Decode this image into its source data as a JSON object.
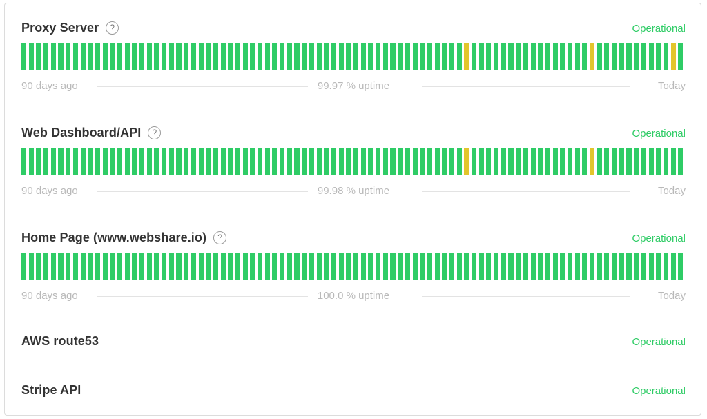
{
  "components": [
    {
      "name": "Proxy Server",
      "has_help": true,
      "help_icon": "question-circle-icon",
      "status": "Operational",
      "uptime_days": 90,
      "minor_days": [
        60,
        77,
        88
      ],
      "left_label": "90 days ago",
      "uptime_label": "99.97 % uptime",
      "right_label": "Today"
    },
    {
      "name": "Web Dashboard/API",
      "has_help": true,
      "help_icon": "question-circle-icon",
      "status": "Operational",
      "uptime_days": 90,
      "minor_days": [
        60,
        77
      ],
      "left_label": "90 days ago",
      "uptime_label": "99.98 % uptime",
      "right_label": "Today"
    },
    {
      "name": "Home Page (www.webshare.io)",
      "has_help": true,
      "help_icon": "question-circle-icon",
      "status": "Operational",
      "uptime_days": 90,
      "minor_days": [],
      "left_label": "90 days ago",
      "uptime_label": "100.0 % uptime",
      "right_label": "Today"
    },
    {
      "name": "AWS route53",
      "has_help": false,
      "status": "Operational"
    },
    {
      "name": "Stripe API",
      "has_help": false,
      "status": "Operational"
    }
  ],
  "colors": {
    "operational": "#2fcc66",
    "minor": "#e2c52c",
    "status_text": "#2fcc66"
  },
  "help_glyph": "?"
}
